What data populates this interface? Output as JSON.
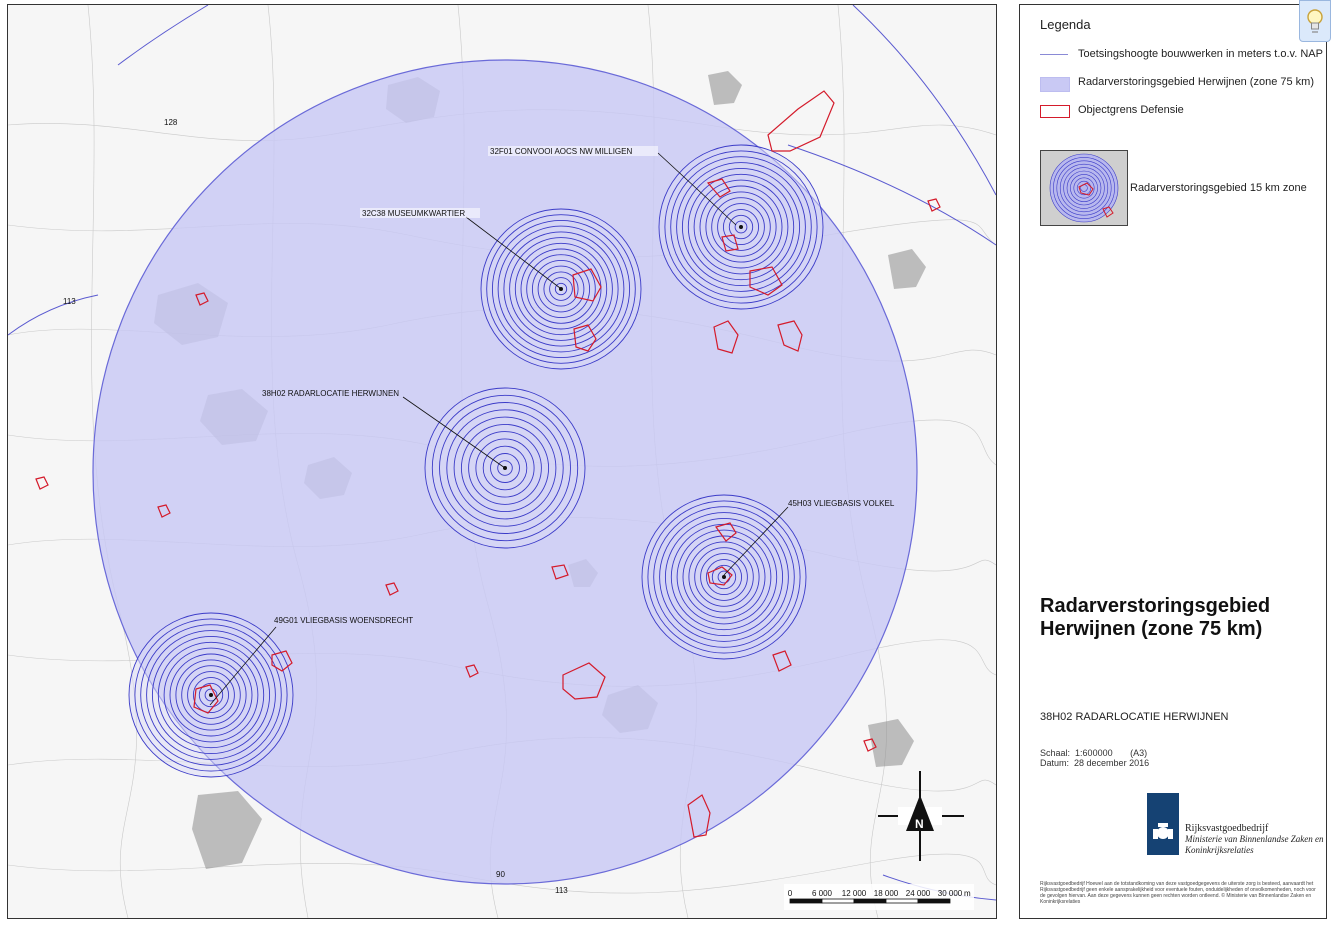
{
  "legend": {
    "title": "Legenda",
    "items": [
      {
        "label": "Toetsingshoogte bouwwerken in meters t.o.v. NAP",
        "symbol": "line"
      },
      {
        "label": "Radarverstoringsgebied Herwijnen (zone 75 km)",
        "symbol": "fill"
      },
      {
        "label": "Objectgrens Defensie",
        "symbol": "outline"
      }
    ],
    "thumbnail_label": "Radarverstoringsgebied 15 km zone"
  },
  "title": {
    "main": "Radarverstoringsgebied Herwijnen (zone 75 km)",
    "location": "38H02 RADARLOCATIE HERWIJNEN"
  },
  "meta": {
    "scale_label": "Schaal:",
    "scale_value": "1:600000",
    "paper": "(A3)",
    "date_label": "Datum:",
    "date_value": "28 december 2016"
  },
  "logo": {
    "org": "Rijksvastgoedbedrijf",
    "ministry": "Ministerie van Binnenlandse Zaken en Koninkrijksrelaties"
  },
  "disclaimer": "Rijksvastgoedbedrijf Hoewel aan de totstandkoming van deze vastgoedgegevens de uiterste zorg is besteed, aanvaardt het Rijksvastgoedbedrijf geen enkele aansprakelijkheid voor eventuele fouten, onduidelijkheden of onvolkomenheden, noch voor de gevolgen hiervan. Aan deze gegevens kunnen geen rechten worden ontleend. © Ministerie van Binnenlandse Zaken en Koninkrijksrelaties",
  "map": {
    "sites": [
      {
        "label": "32F01 CONVOOI AOCS NW MILLIGEN"
      },
      {
        "label": "32C38 MUSEUMKWARTIER"
      },
      {
        "label": "38H02 RADARLOCATIE HERWIJNEN"
      },
      {
        "label": "45H03 VLIEGBASIS VOLKEL"
      },
      {
        "label": "49G01 VLIEGBASIS WOENSDRECHT"
      }
    ],
    "contour_labels": [
      "128",
      "113",
      "113",
      "90"
    ],
    "north_arrow": "N",
    "scale_bar": [
      "0",
      "6 000",
      "12 000",
      "18 000",
      "24 000",
      "30 000"
    ],
    "scale_unit": "m",
    "colors": {
      "zone_fill": "#c8c8f4",
      "zone_stroke": "#6a6ad8",
      "ring_stroke": "#3b3bc8",
      "defence_outline": "#d41b2b",
      "urban": "#8c8c8c"
    }
  }
}
